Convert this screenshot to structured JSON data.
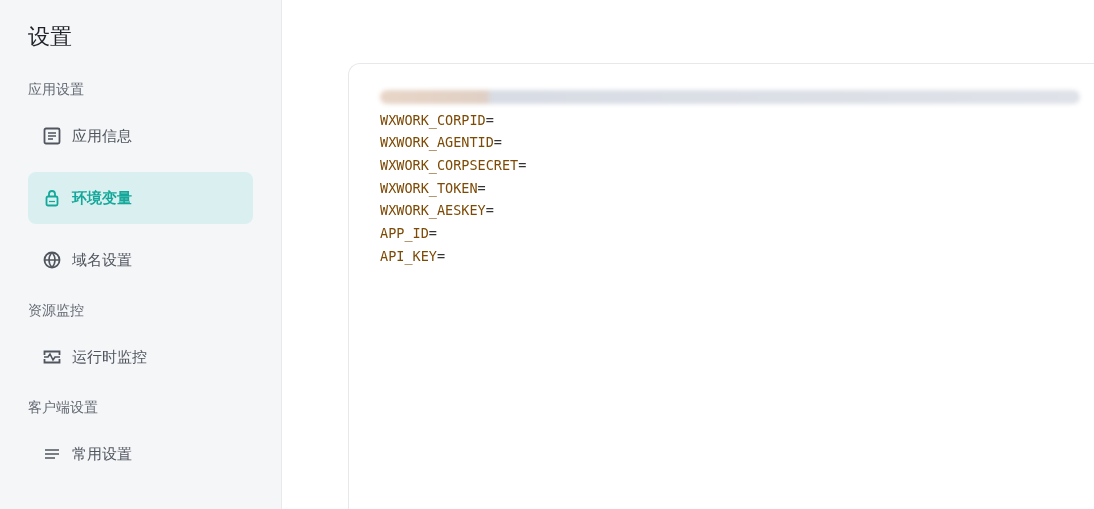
{
  "sidebar": {
    "title": "设置",
    "groups": [
      {
        "label": "应用设置",
        "items": [
          {
            "label": "应用信息",
            "kind": "document",
            "selected": false
          },
          {
            "label": "环境变量",
            "kind": "lock",
            "selected": true
          },
          {
            "label": "域名设置",
            "kind": "globe",
            "selected": false
          }
        ]
      },
      {
        "label": "资源监控",
        "items": [
          {
            "label": "运行时监控",
            "kind": "monitor",
            "selected": false
          }
        ]
      },
      {
        "label": "客户端设置",
        "items": [
          {
            "label": "常用设置",
            "kind": "lines",
            "selected": false
          }
        ]
      }
    ]
  },
  "editor": {
    "redacted_first_line": true,
    "lines": [
      {
        "key": "WXWORK_CORPID",
        "sign": "="
      },
      {
        "key": "WXWORK_AGENTID",
        "sign": "="
      },
      {
        "key": "WXWORK_CORPSECRET",
        "sign": "="
      },
      {
        "key": "WXWORK_TOKEN",
        "sign": "="
      },
      {
        "key": "WXWORK_AESKEY",
        "sign": "="
      },
      {
        "key": "APP_ID",
        "sign": "="
      },
      {
        "key": "API_KEY",
        "sign": "="
      }
    ]
  }
}
